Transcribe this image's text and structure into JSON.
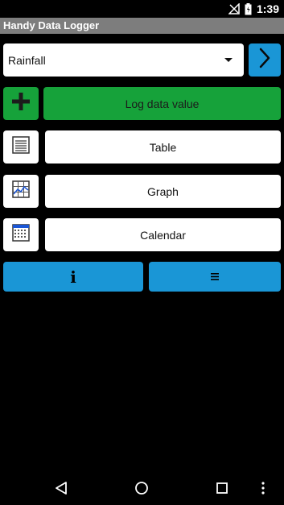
{
  "status_bar": {
    "time": "1:39",
    "icons": [
      "no-signal-icon",
      "battery-icon"
    ]
  },
  "app": {
    "title": "Handy Data Logger"
  },
  "selector": {
    "selected": "Rainfall",
    "next_icon": "chevron-right-icon"
  },
  "actions": {
    "add_icon": "plus-icon",
    "log_label": "Log data value",
    "table_label": "Table",
    "graph_label": "Graph",
    "calendar_label": "Calendar",
    "info_label": "i",
    "menu_icon": "menu-icon"
  },
  "colors": {
    "accent_blue": "#1a96d6",
    "accent_green": "#16a23a",
    "app_bar": "#7d7d7d"
  },
  "nav": {
    "icons": [
      "back-icon",
      "home-icon",
      "recents-icon",
      "overflow-icon"
    ]
  }
}
